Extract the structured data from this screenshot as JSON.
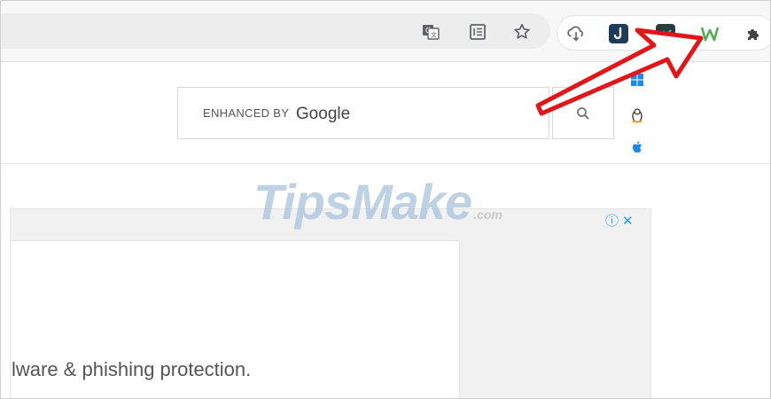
{
  "search": {
    "label_prefix": "ENHANCED BY",
    "label_brand": "Google"
  },
  "ad": {
    "text": "lware & phishing protection.",
    "close_label": "✕",
    "info_label": "ⓘ"
  },
  "watermark": {
    "text": "TipsMake",
    "suffix": ".com"
  },
  "toolbar_icons": [
    "translate-icon",
    "reader-mode-icon",
    "bookmark-star-icon"
  ],
  "extension_icons": [
    "cloud-download-icon",
    "extension-j-icon",
    "extension-teal-icon",
    "extension-w-icon",
    "puzzle-extensions-icon"
  ],
  "os_icons": [
    "windows-icon",
    "linux-icon",
    "apple-icon"
  ],
  "colors": {
    "accent_red": "#e0161b",
    "ad_info_blue": "#1da1f2",
    "watermark_blue": "#a9c3dc"
  }
}
